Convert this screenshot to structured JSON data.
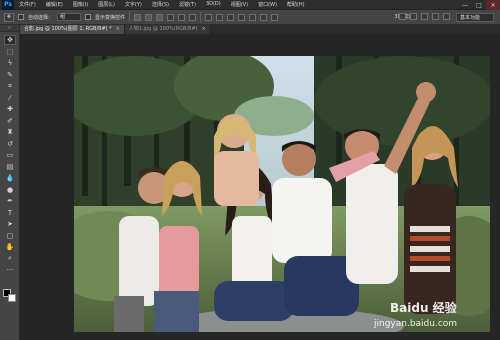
{
  "app": {
    "logo": "Ps"
  },
  "menu": {
    "items": [
      "文件(F)",
      "编辑(E)",
      "图像(I)",
      "图层(L)",
      "文字(Y)",
      "选择(S)",
      "滤镜(T)",
      "3D(D)",
      "视图(V)",
      "窗口(W)",
      "帮助(H)"
    ]
  },
  "window_controls": {
    "minimize": "—",
    "maximize": "□",
    "close": "✕"
  },
  "options": {
    "auto_select_label": "自动选择：",
    "auto_select_value": "组",
    "show_transform_label": "显示变换控件",
    "mode_3d_label": "3D 模式：",
    "workspace": "基本功能"
  },
  "tabs": [
    {
      "label": "合影.jpg @ 100%(图层 1, RGB/8#) *",
      "active": true
    },
    {
      "label": "人物1.jpg @ 100%(RGB/8#)",
      "active": false
    }
  ],
  "tools": [
    {
      "icon": "move-tool-icon",
      "glyph": "✥"
    },
    {
      "icon": "marquee-tool-icon",
      "glyph": "⬚"
    },
    {
      "icon": "lasso-tool-icon",
      "glyph": "ϟ"
    },
    {
      "icon": "quick-select-tool-icon",
      "glyph": "✎"
    },
    {
      "icon": "crop-tool-icon",
      "glyph": "⌗"
    },
    {
      "icon": "eyedropper-tool-icon",
      "glyph": "⁄"
    },
    {
      "icon": "healing-brush-tool-icon",
      "glyph": "✚"
    },
    {
      "icon": "brush-tool-icon",
      "glyph": "✐"
    },
    {
      "icon": "clone-stamp-tool-icon",
      "glyph": "♜"
    },
    {
      "icon": "history-brush-tool-icon",
      "glyph": "↺"
    },
    {
      "icon": "eraser-tool-icon",
      "glyph": "▭"
    },
    {
      "icon": "gradient-tool-icon",
      "glyph": "▤"
    },
    {
      "icon": "blur-tool-icon",
      "glyph": "💧"
    },
    {
      "icon": "dodge-tool-icon",
      "glyph": "●"
    },
    {
      "icon": "pen-tool-icon",
      "glyph": "✒"
    },
    {
      "icon": "type-tool-icon",
      "glyph": "T"
    },
    {
      "icon": "path-select-tool-icon",
      "glyph": "➤"
    },
    {
      "icon": "shape-tool-icon",
      "glyph": "▢"
    },
    {
      "icon": "hand-tool-icon",
      "glyph": "✋"
    },
    {
      "icon": "zoom-tool-icon",
      "glyph": "⌕"
    },
    {
      "icon": "more-tools-icon",
      "glyph": "···"
    }
  ],
  "colors": {
    "accent": "#31a8ff",
    "foreground": "#000000",
    "background": "#ffffff",
    "canvas_bg": "#262626"
  },
  "watermark": {
    "brand": "Baidu 经验",
    "url": "jingyan.baidu.com"
  }
}
